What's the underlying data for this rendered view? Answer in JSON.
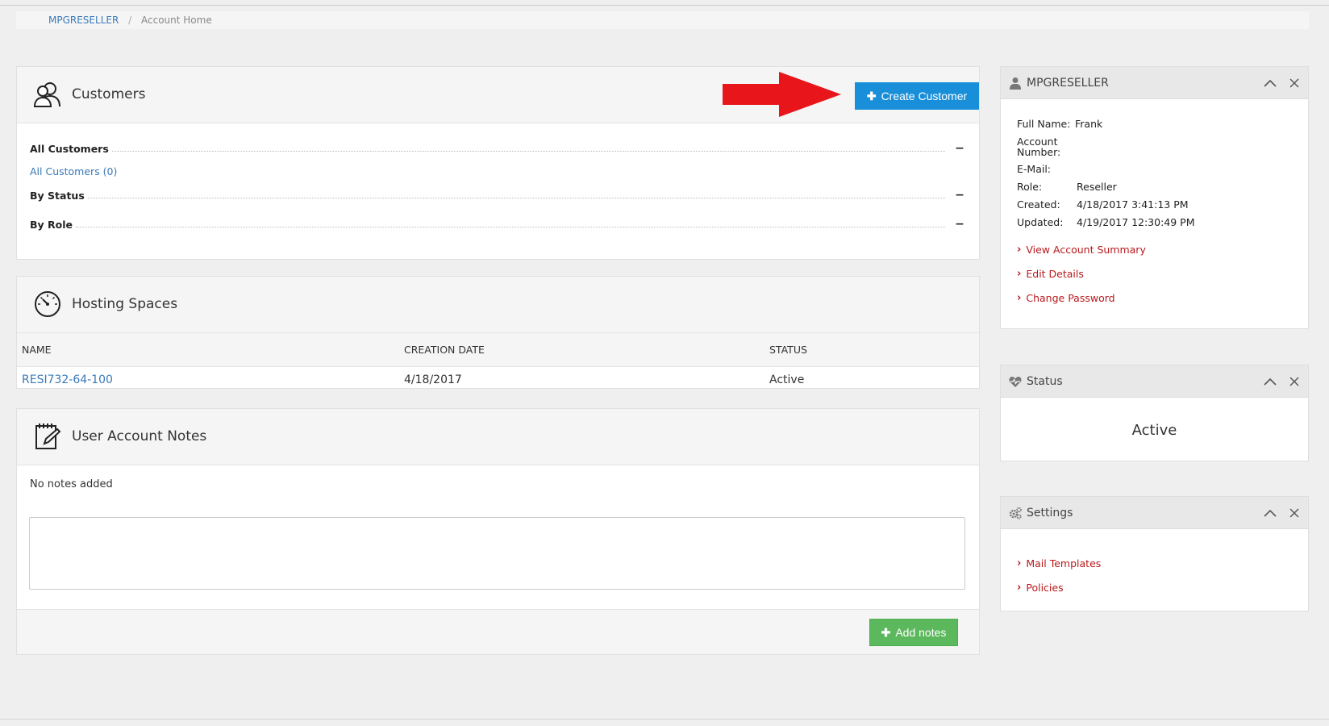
{
  "breadcrumb": {
    "root": "MPGRESELLER",
    "separator": "/",
    "current": "Account Home"
  },
  "customers": {
    "title": "Customers",
    "create_button": "Create Customer",
    "filters": {
      "all_customers_heading": "All Customers",
      "all_customers_link": "All Customers (0)",
      "by_status": "By Status",
      "by_role": "By Role",
      "toggle": "−"
    }
  },
  "hosting": {
    "title": "Hosting Spaces",
    "columns": [
      "NAME",
      "CREATION DATE",
      "STATUS"
    ],
    "rows": [
      {
        "name": "RESI732-64-100",
        "date": "4/18/2017",
        "status": "Active"
      }
    ]
  },
  "notes": {
    "title": "User Account Notes",
    "empty_text": "No notes added",
    "textarea_value": "",
    "add_button": "Add notes"
  },
  "account_widget": {
    "title": "MPGRESELLER",
    "fields": [
      {
        "label": "Full Name:",
        "value": "Frank"
      },
      {
        "label": "Account Number:",
        "value": ""
      },
      {
        "label": "E-Mail:",
        "value": ""
      },
      {
        "label": "Role:",
        "value": "Reseller"
      },
      {
        "label": "Created:",
        "value": "4/18/2017 3:41:13 PM"
      },
      {
        "label": "Updated:",
        "value": "4/19/2017 12:30:49 PM"
      }
    ],
    "links": [
      "View Account Summary",
      "Edit Details",
      "Change Password"
    ]
  },
  "status_widget": {
    "title": "Status",
    "value": "Active"
  },
  "settings_widget": {
    "title": "Settings",
    "links": [
      "Mail Templates",
      "Policies"
    ]
  },
  "colors": {
    "primary": "#1a8fd9",
    "success": "#5cb85c",
    "link": "#3a7ab8",
    "danger_link": "#b9191d",
    "arrow": "#e8161b"
  },
  "icons": {
    "customers": "users-icon",
    "hosting": "gauge-icon",
    "notes": "notepad-icon",
    "account": "user-icon",
    "status": "heartbeat-icon",
    "settings": "gears-icon"
  }
}
